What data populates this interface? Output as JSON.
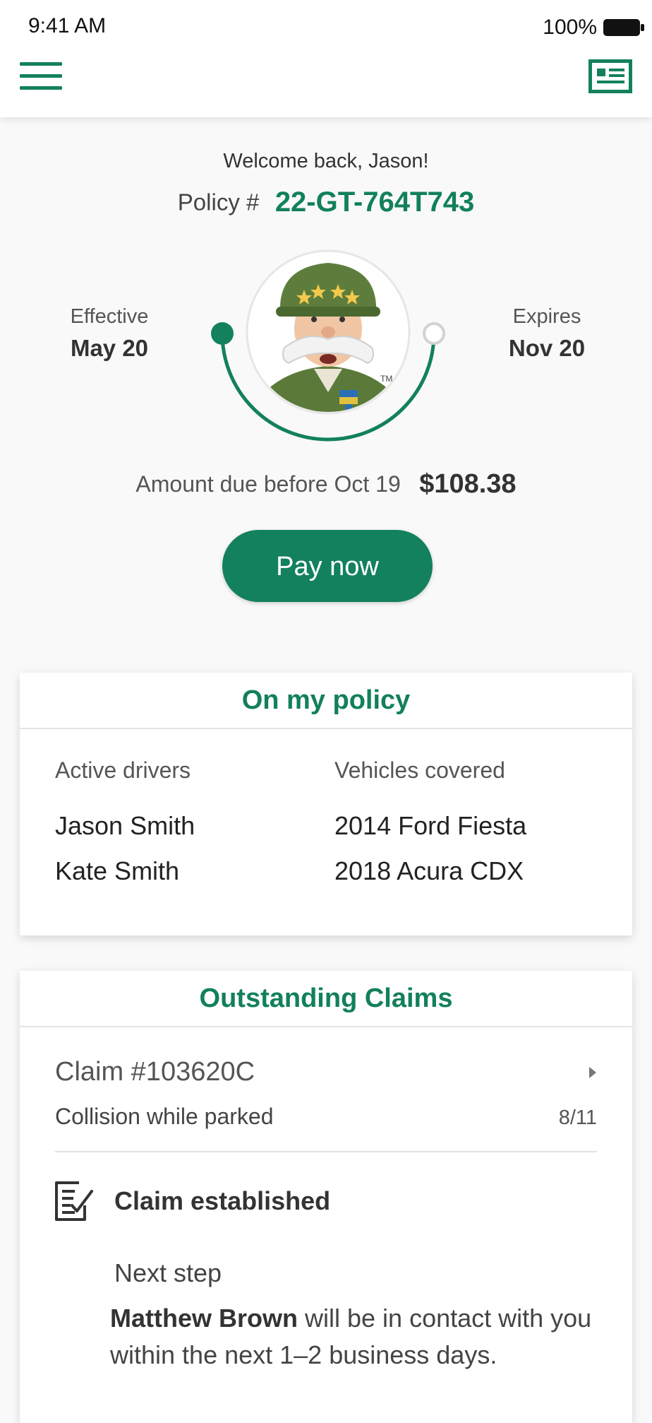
{
  "status_bar": {
    "time": "9:41 AM",
    "battery_percent": "100%",
    "battery_icon": "battery-full-icon"
  },
  "header": {
    "menu_icon": "hamburger-menu-icon",
    "card_icon": "id-card-icon"
  },
  "greeting": "Welcome back, Jason!",
  "policy": {
    "label": "Policy #",
    "number": "22-GT-764T743",
    "effective_label": "Effective",
    "effective_date": "May 20",
    "expires_label": "Expires",
    "expires_date": "Nov 20",
    "mascot_tm": "TM",
    "term_progress": 0.0
  },
  "payment": {
    "amount_label": "Amount due before Oct 19",
    "amount": "$108.38",
    "pay_button_label": "Pay now"
  },
  "on_my_policy": {
    "title": "On my policy",
    "drivers_header": "Active drivers",
    "drivers": [
      "Jason Smith",
      "Kate Smith"
    ],
    "vehicles_header": "Vehicles covered",
    "vehicles": [
      "2014 Ford Fiesta",
      "2018 Acura CDX"
    ]
  },
  "claims": {
    "title": "Outstanding Claims",
    "items": [
      {
        "title": "Claim #103620C",
        "description": "Collision while parked",
        "date": "8/11",
        "status_icon": "clipboard-check-icon",
        "status": "Claim established",
        "next_step_label": "Next step",
        "next_step_contact": "Matthew Brown",
        "next_step_text": " will be in contact with you within the next 1–2 business days."
      }
    ]
  },
  "colors": {
    "brand_green": "#13805e",
    "text_dark": "#333333",
    "background": "#f9f9f9"
  }
}
